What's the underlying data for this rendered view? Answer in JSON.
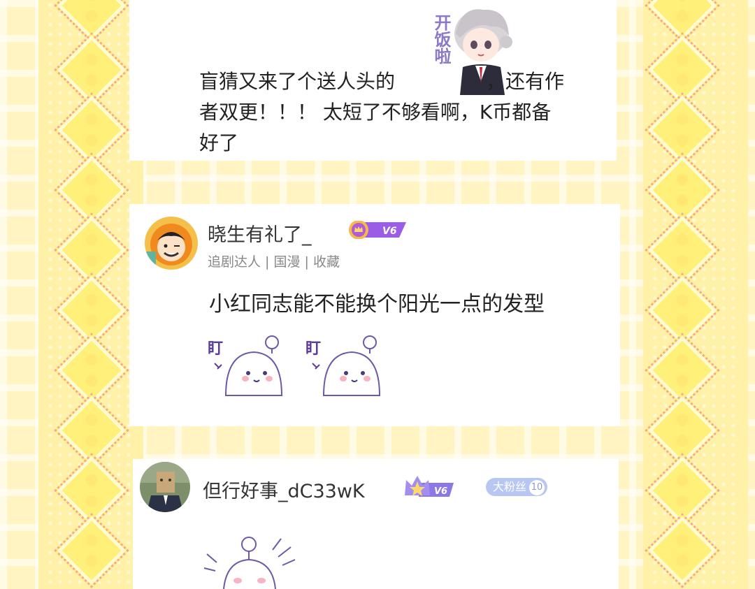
{
  "post1": {
    "line1_before": "盲猜又来了个送人头的",
    "line1_after": "，还有作",
    "line2": "者双更！！！ 太短了不够看啊，K币都备",
    "line3": "好了",
    "sticker_text": "开饭啦",
    "sticker_icon": "anime-boy-sticker"
  },
  "comment2": {
    "username": "晓生有礼了_",
    "level": "V6",
    "tags": "追剧达人 | 国漫 | 收藏",
    "text": "小红同志能不能换个阳光一点的发型",
    "sticker_label": "盯",
    "sticker_icon": "staring-rice-ball-sticker"
  },
  "comment3": {
    "username": "但行好事_dC33wK",
    "level": "V6",
    "fan_badge": "大粉丝",
    "fan_level": "10",
    "sticker_icon": "shocked-rice-ball-sticker"
  },
  "colors": {
    "background": "#fff4c2",
    "level_purple": "#8b5cf6",
    "fan_badge": "#b8c7f2"
  }
}
